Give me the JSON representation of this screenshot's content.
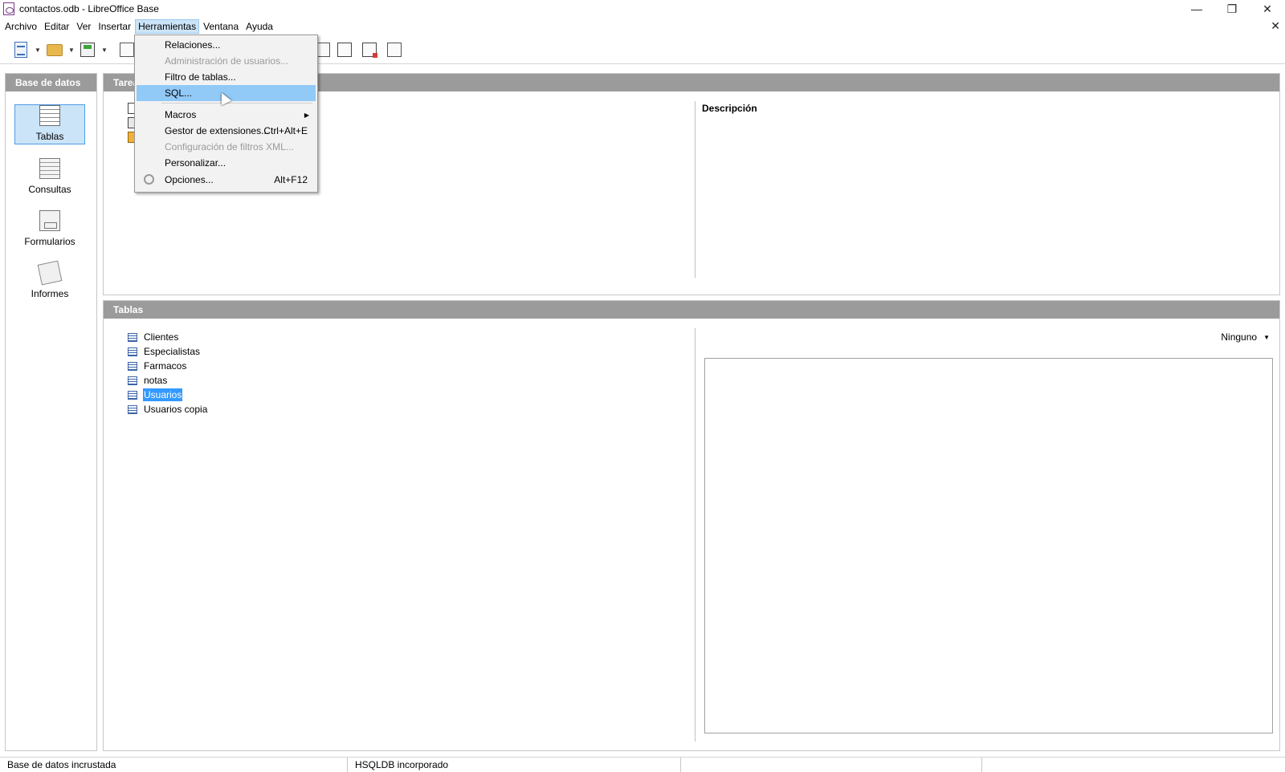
{
  "window": {
    "title": "contactos.odb - LibreOffice Base",
    "controls": {
      "minimize": "—",
      "maximize": "❐",
      "close": "✕"
    },
    "doc_close": "✕"
  },
  "menubar": {
    "items": [
      {
        "label": "Archivo"
      },
      {
        "label": "Editar"
      },
      {
        "label": "Ver"
      },
      {
        "label": "Insertar"
      },
      {
        "label": "Herramientas",
        "active": true
      },
      {
        "label": "Ventana"
      },
      {
        "label": "Ayuda"
      }
    ]
  },
  "tools_menu": {
    "items": [
      {
        "label": "Relaciones...",
        "shortcut": "",
        "enabled": true
      },
      {
        "label": "Administración de usuarios...",
        "shortcut": "",
        "enabled": false
      },
      {
        "label": "Filtro de tablas...",
        "shortcut": "",
        "enabled": true
      },
      {
        "label": "SQL...",
        "shortcut": "",
        "enabled": true,
        "highlighted": true
      },
      {
        "label": "Macros",
        "shortcut": "",
        "enabled": true,
        "submenu": true
      },
      {
        "label": "Gestor de extensiones...",
        "shortcut": "Ctrl+Alt+E",
        "enabled": true
      },
      {
        "label": "Configuración de filtros XML...",
        "shortcut": "",
        "enabled": false
      },
      {
        "label": "Personalizar...",
        "shortcut": "",
        "enabled": true
      },
      {
        "label": "Opciones...",
        "shortcut": "Alt+F12",
        "enabled": true,
        "icon": "gear-icon"
      }
    ]
  },
  "left_panel": {
    "header": "Base de datos",
    "items": [
      {
        "label": "Tablas",
        "icon": "tables-icon",
        "selected": true
      },
      {
        "label": "Consultas",
        "icon": "queries-icon"
      },
      {
        "label": "Formularios",
        "icon": "forms-icon"
      },
      {
        "label": "Informes",
        "icon": "reports-icon"
      }
    ]
  },
  "tasks_panel": {
    "header": "Tareas",
    "description_label": "Descripción"
  },
  "tables_panel": {
    "header": "Tablas",
    "tables": [
      "Clientes",
      "Especialistas",
      "Farmacos",
      "notas",
      "Usuarios",
      "Usuarios copia"
    ],
    "selected_table": "Usuarios",
    "preview_option": "Ninguno"
  },
  "statusbar": {
    "db_type": "Base de datos incrustada",
    "engine": "HSQLDB incorporado"
  },
  "colors": {
    "panel_header": "#9b9b9b",
    "selection": "#3399ff",
    "menu_highlight": "#91c9f7"
  }
}
